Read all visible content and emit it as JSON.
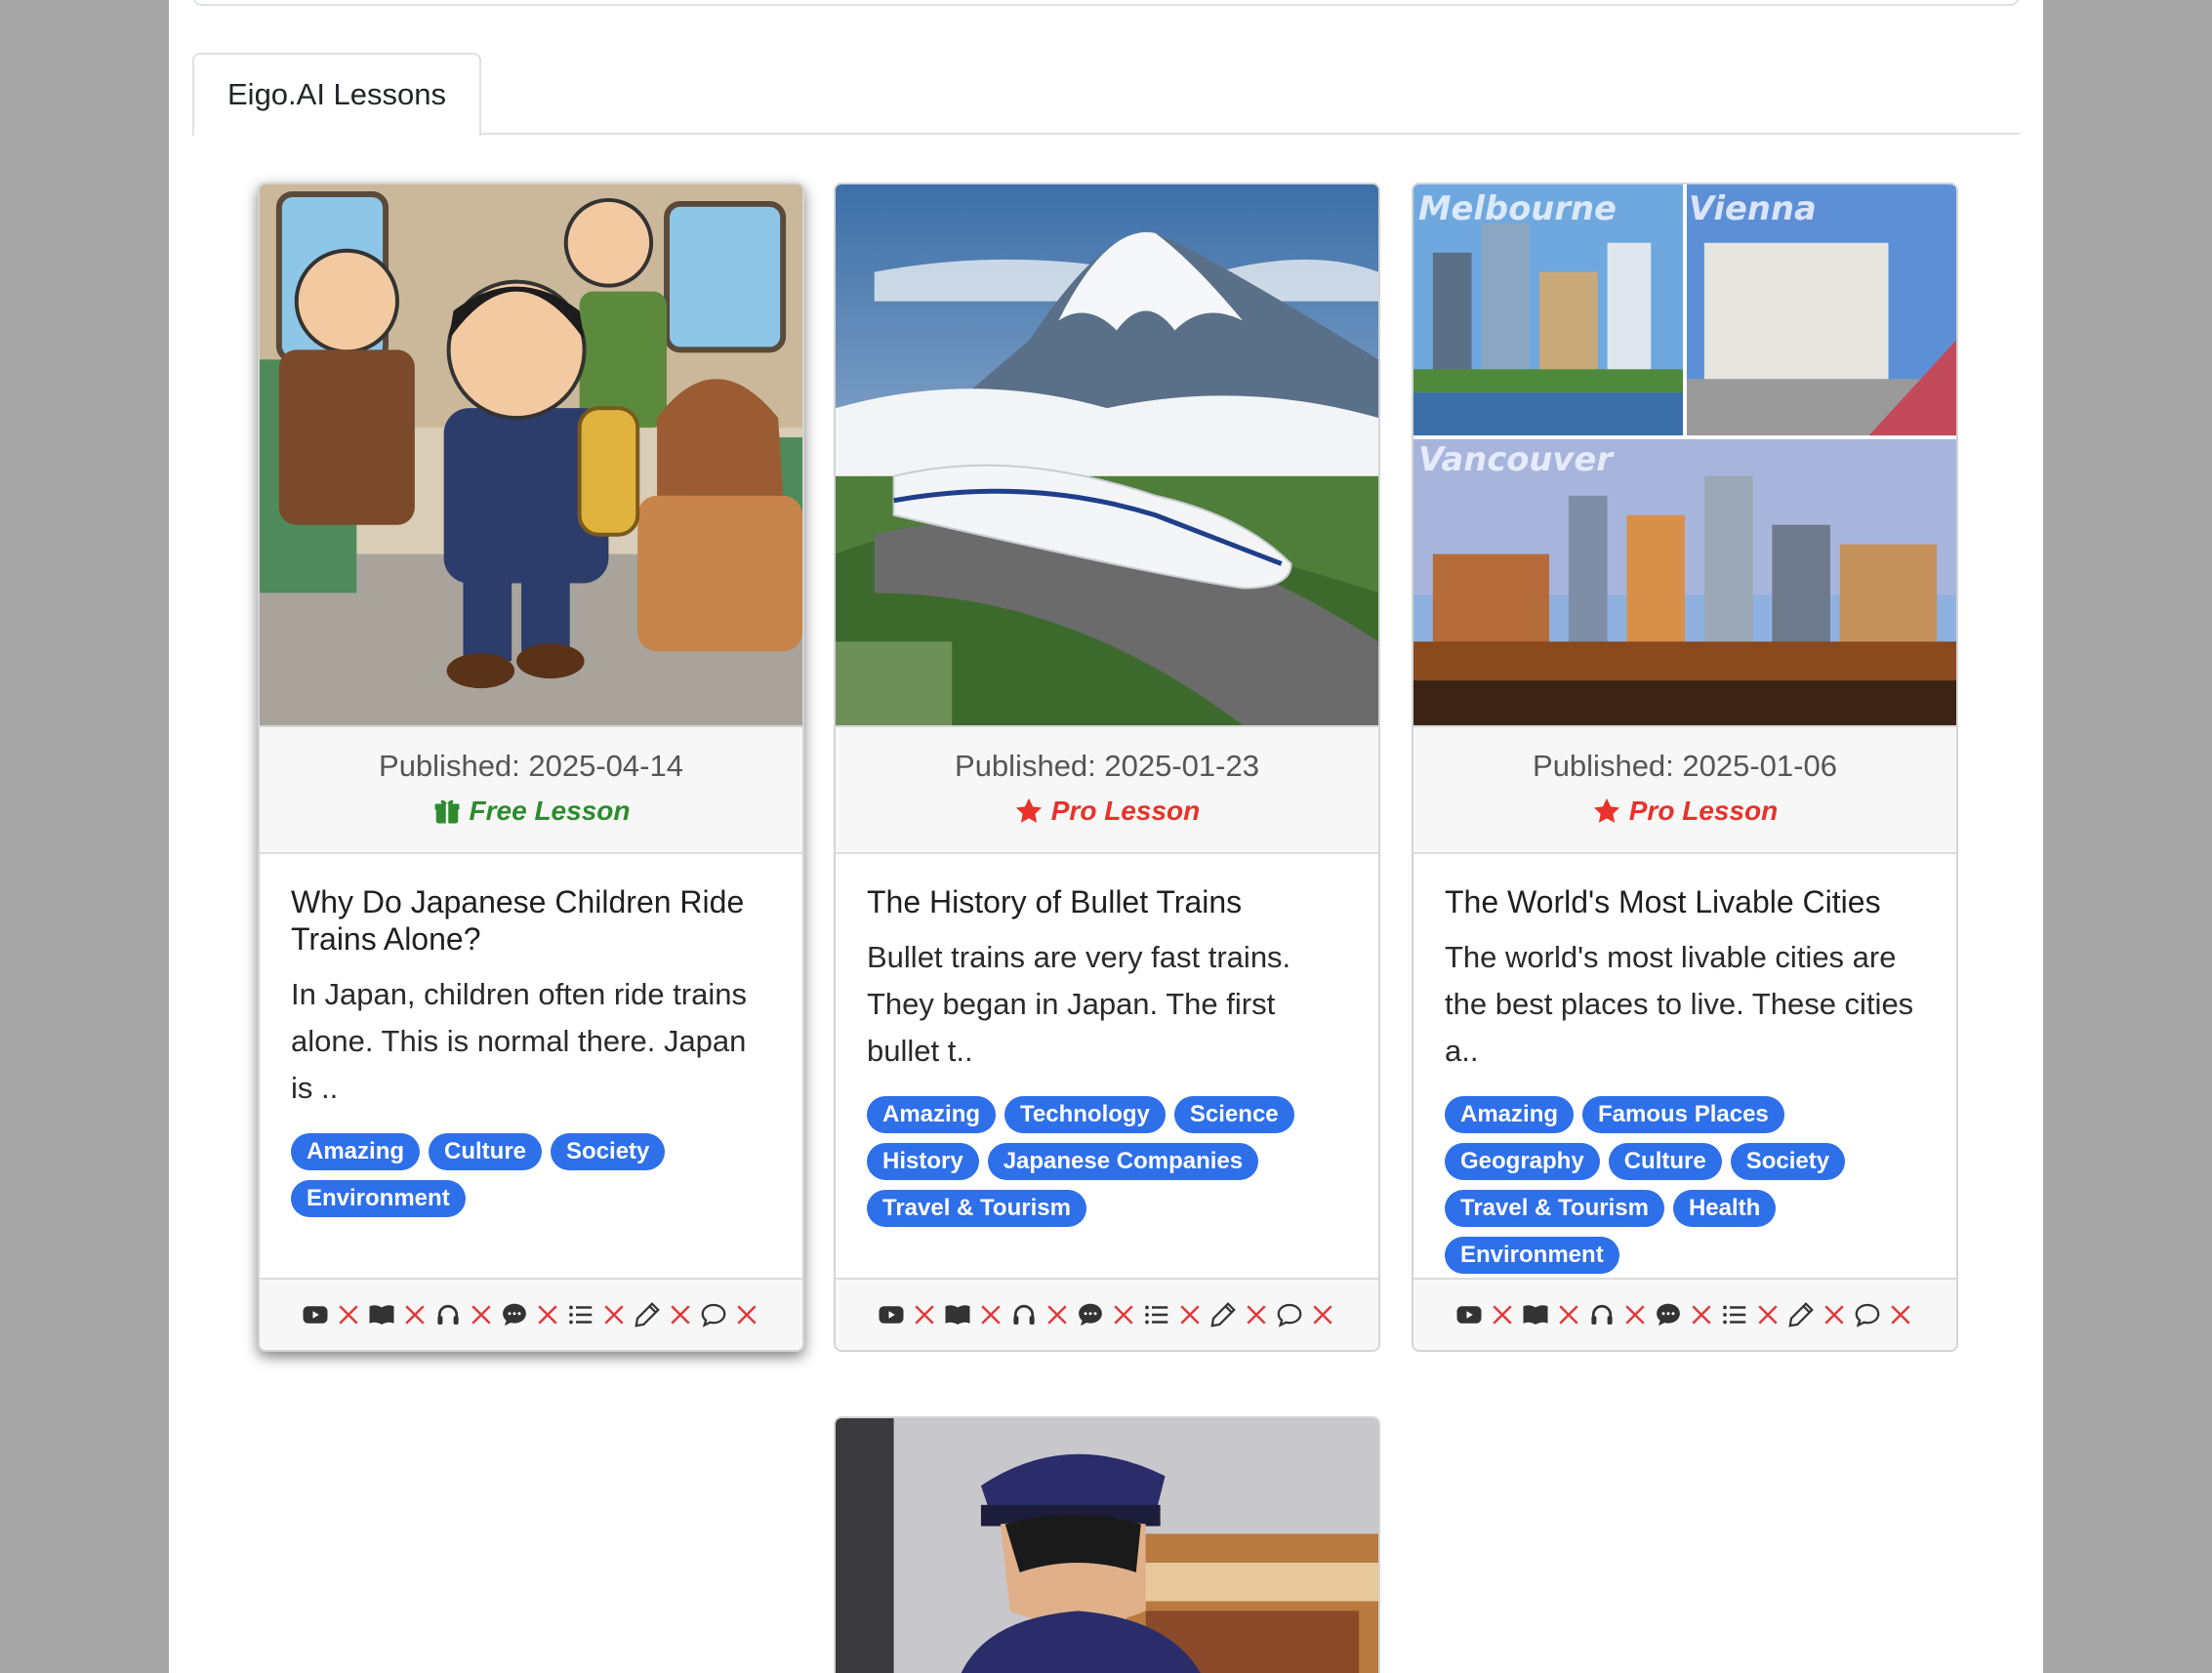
{
  "tabs": [
    {
      "label": "Eigo.AI Lessons"
    }
  ],
  "cards": [
    {
      "published": "Published: 2025-04-14",
      "badge": "Free Lesson",
      "title": "Why Do Japanese Children Ride Trains Alone?",
      "excerpt": "In Japan, children often ride trains alone. This is normal there. Japan is ..",
      "tags": [
        "Amazing",
        "Culture",
        "Society",
        "Environment"
      ]
    },
    {
      "published": "Published: 2025-01-23",
      "badge": "Pro Lesson",
      "title": "The History of Bullet Trains",
      "excerpt": "Bullet trains are very fast trains. They began in Japan. The first bullet t..",
      "tags": [
        "Amazing",
        "Technology",
        "Science",
        "History",
        "Japanese Companies",
        "Travel & Tourism"
      ]
    },
    {
      "published": "Published: 2025-01-06",
      "badge": "Pro Lesson",
      "title": "The World's Most Livable Cities",
      "excerpt": "The world's most livable cities are the best places to live. These cities a..",
      "tags": [
        "Amazing",
        "Famous Places",
        "Geography",
        "Culture",
        "Society",
        "Travel & Tourism",
        "Health",
        "Environment"
      ],
      "image_labels": [
        "Melbourne",
        "Vienna",
        "Vancouver"
      ]
    }
  ],
  "footer_icons": [
    "video-icon",
    "reading-icon",
    "listening-icon",
    "speaking-icon",
    "quiz-icon",
    "writing-icon",
    "discussion-icon"
  ],
  "colors": {
    "tag": "#2e6fea",
    "free": "#2e8b2e",
    "pro": "#e8322a",
    "missing": "#e03a3a"
  }
}
